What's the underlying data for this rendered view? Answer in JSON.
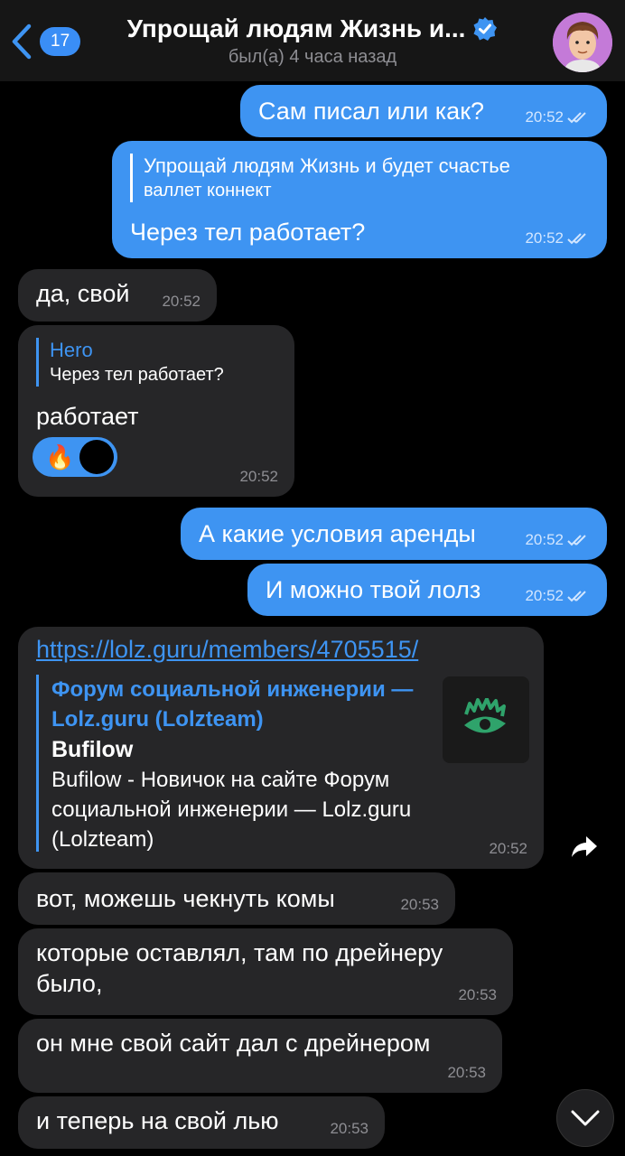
{
  "header": {
    "back_count": "17",
    "title": "Упрощай людям Жизнь и...",
    "status": "был(а) 4 часа назад",
    "accent": "#3e94f2"
  },
  "messages": [
    {
      "dir": "out",
      "text": "Сам писал или как?",
      "time": "20:52"
    },
    {
      "dir": "out",
      "reply_name": "Упрощай людям Жизнь и будет счастье",
      "reply_text": "валлет коннект",
      "text": "Через тел работает?",
      "time": "20:52"
    },
    {
      "dir": "in",
      "text": "да, свой",
      "time": "20:52"
    },
    {
      "dir": "in",
      "reply_name": "Hero",
      "reply_text": "Через тел работает?",
      "text": "работает",
      "reaction": "🔥",
      "time": "20:52"
    },
    {
      "dir": "out",
      "text": "А какие условия аренды",
      "time": "20:52"
    },
    {
      "dir": "out",
      "text": "И можно твой лолз",
      "time": "20:52"
    },
    {
      "dir": "in",
      "link": "https://lolz.guru/members/4705515/",
      "preview_site": "Форум социальной инженерии — Lolz.guru (Lolzteam)",
      "preview_title": "Bufilow",
      "preview_desc": "Bufilow - Новичок на сайте Форум социальной инженерии — Lolz.guru (Lolzteam)",
      "time": "20:52"
    },
    {
      "dir": "in",
      "text": "вот, можешь чекнуть комы",
      "time": "20:53"
    },
    {
      "dir": "in",
      "text": "которые оставлял, там по дрейнеру было,",
      "time": "20:53"
    },
    {
      "dir": "in",
      "text": "он мне свой сайт дал с дрейнером",
      "time": "20:53"
    },
    {
      "dir": "in",
      "text": "и теперь на свой лью",
      "time": "20:53"
    }
  ]
}
